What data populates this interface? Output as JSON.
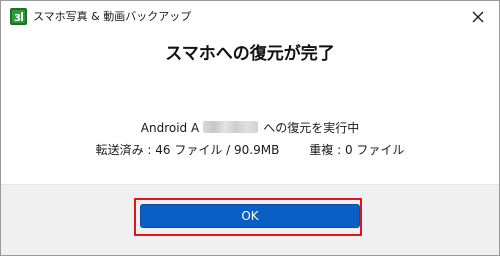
{
  "window": {
    "title": "スマホ写真 & 動画バックアップ",
    "app_icon": "app-logo-icon",
    "close_icon": "close-icon"
  },
  "dialog": {
    "heading": "スマホへの復元が完了",
    "status_prefix": "Android A",
    "status_suffix": "への復元を実行中",
    "transferred": "転送済み : 46 ファイル / 90.9MB",
    "duplicates": "重複 : 0 ファイル"
  },
  "footer": {
    "ok_label": "OK"
  },
  "colors": {
    "accent": "#0a5fc4",
    "highlight": "#e0141e",
    "footer_bg": "#f0f0f0"
  }
}
